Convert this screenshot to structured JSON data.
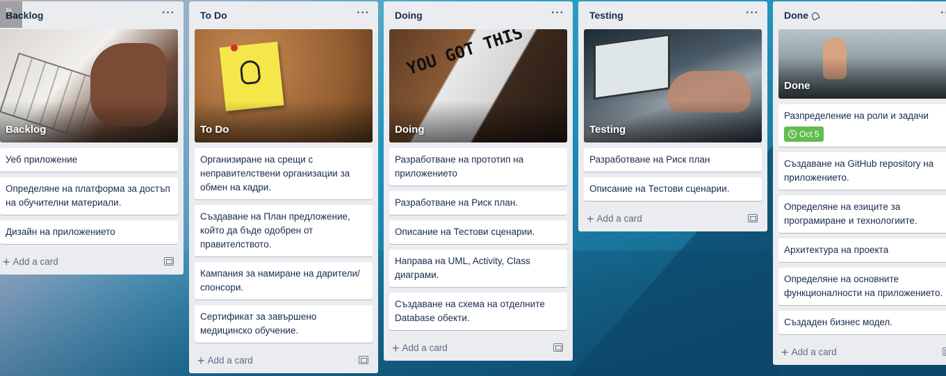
{
  "board": {
    "collapse_icon": "double-chevron-right-icon",
    "lists": [
      {
        "title": "Backlog",
        "menu": "···",
        "cover_title": "Backlog",
        "cards": [
          "Уеб приложение",
          "Определяне на платформа за достъп на обучителни материали.",
          "Дизайн на приложението"
        ],
        "add_label": "Add a card"
      },
      {
        "title": "To Do",
        "menu": "···",
        "cover_title": "To Do",
        "cards": [
          "Организиране на срещи с неправителствени организации за обмен на кадри.",
          "Създаване на План предложение, който да бъде одобрен от правителството.",
          "Кампания за намиране на дарители/ спонсори.",
          "Сертификат за завършено медицинско обучение."
        ],
        "add_label": "Add a card"
      },
      {
        "title": "Doing",
        "menu": "···",
        "cover_title": "Doing",
        "cover_text": "YOU GOT THIS",
        "cards": [
          "Разработване на прототип на приложението",
          "Разработване на Риск план.",
          "Описание на Тестови сценарии.",
          "Направа на UML, Activity, Class диаграми.",
          "Създаване на схема на отделните Database обекти."
        ],
        "add_label": "Add a card"
      },
      {
        "title": "Testing",
        "menu": "···",
        "cover_title": "Testing",
        "cards": [
          "Разработване на Риск план",
          "Описание на Тестови сценарии."
        ],
        "add_label": "Add a card"
      },
      {
        "title": "Done",
        "menu": "···",
        "title_icon": "bell-icon",
        "cover_title": "Done",
        "cards": [
          "Разпределение на роли и задачи",
          "Създаване на GitHub repository на приложението.",
          "Определяне на езиците за програмиране и технологиите.",
          "Архитектура на проекта",
          "Определяне на основните функционалности на приложението.",
          "Създаден бизнес модел."
        ],
        "first_card_badge": "Oct 5",
        "badge_color": "#61bd4f",
        "add_label": "Add a card"
      }
    ]
  }
}
